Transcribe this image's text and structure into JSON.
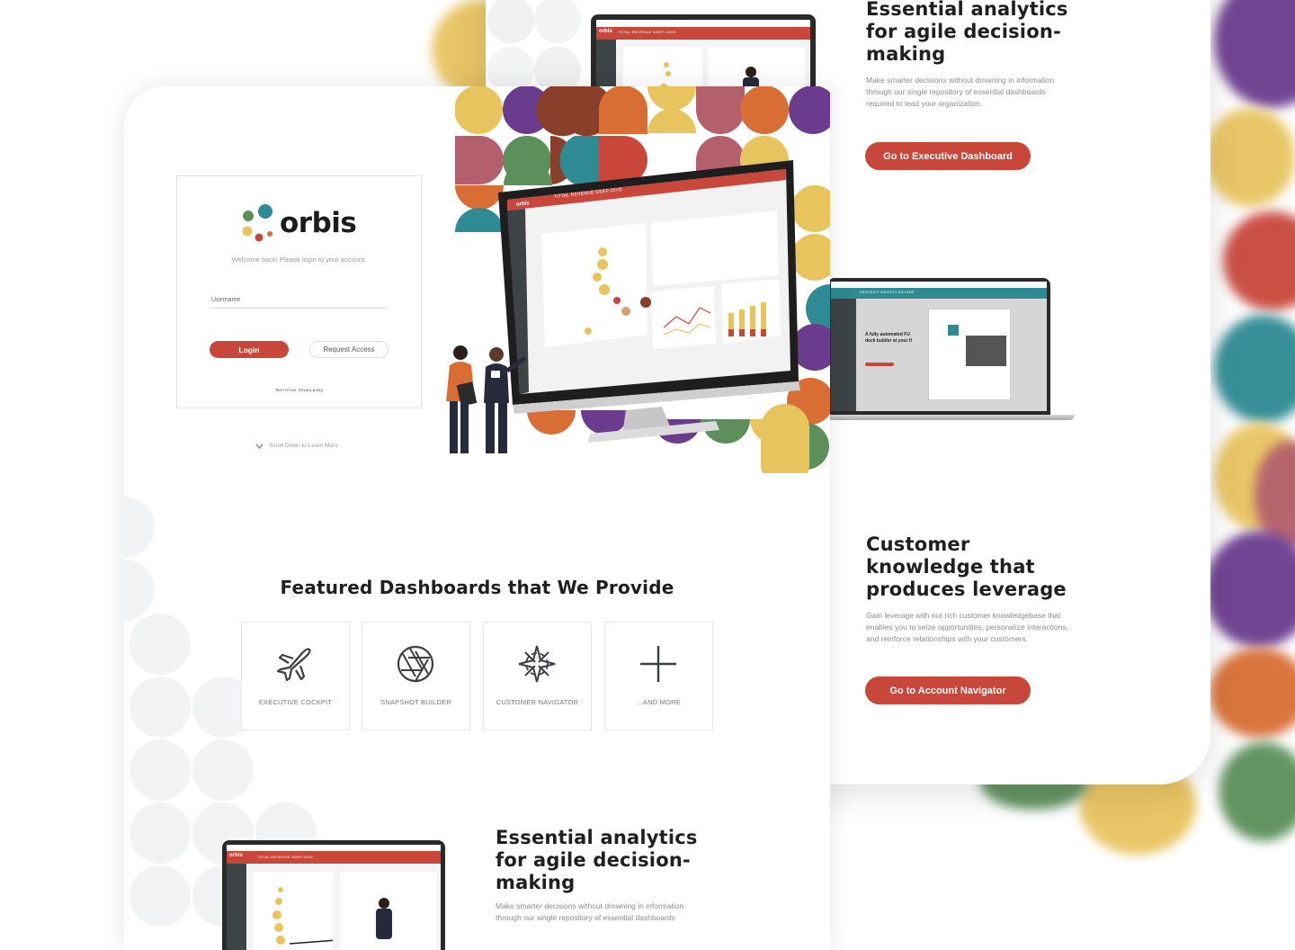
{
  "brand": {
    "name": "orbis",
    "accent": "#c9473a",
    "colors": [
      "#e8c45f",
      "#6b3c8e",
      "#c9473a",
      "#d86e33",
      "#5c8f5a",
      "#2e8a93",
      "#b45f6c",
      "#8a3f2a"
    ]
  },
  "login": {
    "welcome": "Welcome back! Please login to your account.",
    "username_label": "Username",
    "login_button": "Login",
    "request_button": "Request Access",
    "footer_links": "Term of use. Privacy policy",
    "scroll_hint": "Scroll Down to Learn More"
  },
  "featured": {
    "title": "Featured Dashboards that We Provide",
    "tiles": [
      {
        "label": "EXECUTIVE COCKPIT",
        "icon": "airplane-icon"
      },
      {
        "label": "SNAPSHOT BUILDER",
        "icon": "aperture-icon"
      },
      {
        "label": "CUSTOMER NAVIGATOR",
        "icon": "compass-icon"
      },
      {
        "label": "...AND MORE",
        "icon": "plus-icon"
      }
    ]
  },
  "section_analytics": {
    "title": "Essential analytics for agile decision-making",
    "title_lines": [
      "Essential analytics",
      "for agile decision-",
      "making"
    ],
    "body_lines": [
      "Make smarter decisions without drowning in information",
      "through our single repository of essential dashboards",
      "required to lead your organization."
    ],
    "button": "Go to Executive Dashboard"
  },
  "section_customer": {
    "title_lines": [
      "Customer",
      "knowledge that",
      "produces leverage"
    ],
    "body_lines": [
      "Gain leverage with our rich customer knowledgebase that",
      "enables you to seize opportunities, personalize interactions,",
      "and reinforce relationships with your customers."
    ],
    "button": "Go to Account Navigator"
  },
  "mockup": {
    "dashboard_title": "TOTAL REVENUE DEEP-DIVE",
    "snapshot_title": "SNAPSHOT INSIGHTS BUILDER",
    "snapshot_caption": "A fully automated FU",
    "snapshot_caption2": "deck builder at your fi",
    "logo": "orbis"
  }
}
